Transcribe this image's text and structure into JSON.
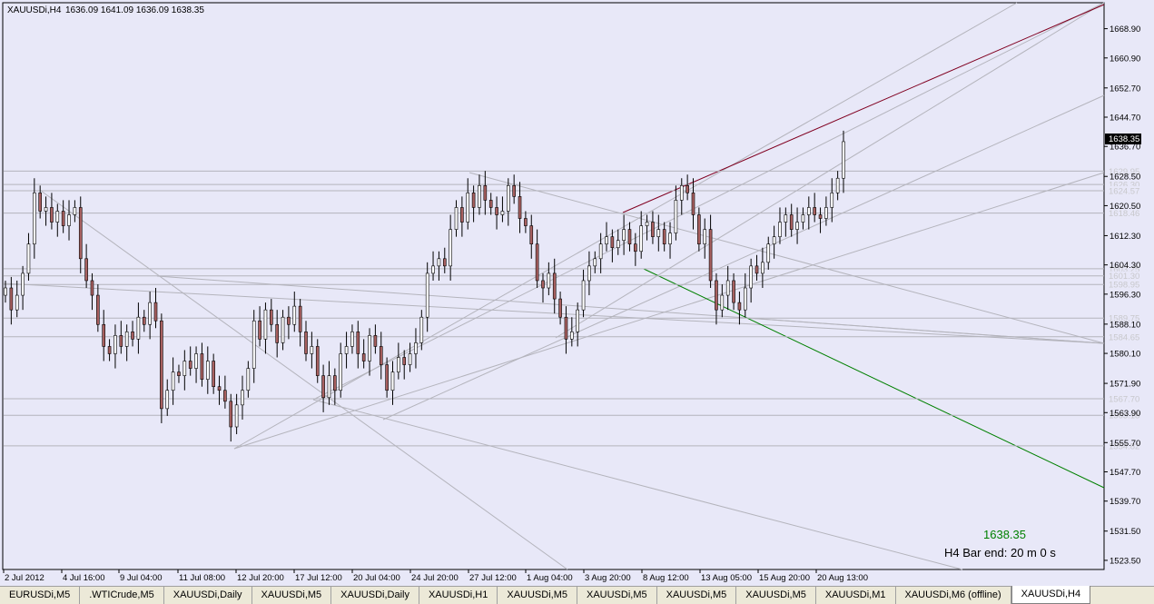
{
  "header": {
    "symbol": "XAUUSDi,H4",
    "ohlc": "1636.09 1641.09 1636.09 1638.35"
  },
  "info": {
    "price": "1638.35",
    "bar_end": "H4 Bar end: 20 m 0 s"
  },
  "colors": {
    "background": "#e8e8f8",
    "bull": "#ffffff",
    "bear": "#a86060",
    "frame": "#000000",
    "red_line": "#800020",
    "green_line": "#008000",
    "grid_line": "#b4b4bc",
    "info_price": "#008000"
  },
  "tabs": [
    "EURUSDi,M5",
    ".WTICrude,M5",
    "XAUUSDi,Daily",
    "XAUUSDi,M5",
    "XAUUSDi,Daily",
    "XAUUSDi,H1",
    "XAUUSDi,M5",
    "XAUUSDi,M5",
    "XAUUSDi,M5",
    "XAUUSDi,M5",
    "XAUUSDi,M1",
    "XAUUSDi,M6 (offline)",
    "XAUUSDi,H4"
  ],
  "active_tab": 12,
  "chart_data": {
    "type": "candlestick",
    "ylim": [
      1521.0,
      1676.0
    ],
    "y_ticks": [
      "1668.90",
      "1660.90",
      "1652.70",
      "1644.70",
      "1636.70",
      "1628.50",
      "1620.50",
      "1612.30",
      "1604.30",
      "1596.30",
      "1588.10",
      "1580.10",
      "1571.90",
      "1563.90",
      "1555.70",
      "1547.70",
      "1539.70",
      "1531.50",
      "1523.50"
    ],
    "current_price": "1638.35",
    "x_labels": [
      "2 Jul 2012",
      "4 Jul 16:00",
      "9 Jul 04:00",
      "11 Jul 08:00",
      "12 Jul 20:00",
      "17 Jul 12:00",
      "20 Jul 04:00",
      "24 Jul 20:00",
      "27 Jul 12:00",
      "1 Aug 04:00",
      "3 Aug 20:00",
      "8 Aug 12:00",
      "13 Aug 05:00",
      "15 Aug 20:00",
      "20 Aug 13:00"
    ],
    "horizontal_levels": [
      {
        "value": 1629.95,
        "label": "1629.95"
      },
      {
        "value": 1626.3,
        "label": "1626.30"
      },
      {
        "value": 1624.57,
        "label": "1624.57"
      },
      {
        "value": 1618.46,
        "label": "1618.46"
      },
      {
        "value": 1603.25,
        "label": "1603.25"
      },
      {
        "value": 1601.3,
        "label": "1601.30"
      },
      {
        "value": 1598.95,
        "label": "1598.95"
      },
      {
        "value": 1589.75,
        "label": "1589.75"
      },
      {
        "value": 1584.65,
        "label": "1584.65"
      },
      {
        "value": 1567.7,
        "label": "1567.70"
      },
      {
        "value": 1563.18,
        "label": "1563.18"
      },
      {
        "value": 1554.82,
        "label": "1554.82"
      }
    ],
    "closes": [
      1598,
      1592,
      1596,
      1602,
      1610,
      1624,
      1619,
      1620,
      1616,
      1619,
      1615,
      1618,
      1620,
      1606,
      1600,
      1596,
      1588,
      1582,
      1580,
      1585,
      1582,
      1586,
      1584,
      1590,
      1588,
      1594,
      1589,
      1565,
      1570,
      1575,
      1574,
      1578,
      1576,
      1580,
      1573,
      1578,
      1571,
      1570,
      1567,
      1560,
      1566,
      1570,
      1576,
      1589,
      1584,
      1592,
      1588,
      1583,
      1590,
      1588,
      1593,
      1586,
      1580,
      1582,
      1574,
      1568,
      1574,
      1570,
      1580,
      1582,
      1586,
      1580,
      1578,
      1585,
      1582,
      1577,
      1570,
      1575,
      1579,
      1577,
      1580,
      1583,
      1590,
      1602,
      1604,
      1606,
      1604,
      1614,
      1620,
      1616,
      1624,
      1620,
      1626,
      1622,
      1620,
      1618,
      1619,
      1626,
      1623,
      1617,
      1615,
      1610,
      1600,
      1598,
      1602,
      1595,
      1590,
      1584,
      1586,
      1592,
      1600,
      1604,
      1606,
      1610,
      1612,
      1609,
      1611,
      1614,
      1610,
      1608,
      1615,
      1616,
      1612,
      1614,
      1610,
      1613,
      1622,
      1626,
      1624,
      1618,
      1610,
      1614,
      1600,
      1592,
      1596,
      1600,
      1594,
      1592,
      1598,
      1604,
      1602,
      1605,
      1610,
      1612,
      1616,
      1618,
      1614,
      1616,
      1618,
      1620,
      1618,
      1617,
      1620,
      1624,
      1628,
      1638
    ]
  }
}
